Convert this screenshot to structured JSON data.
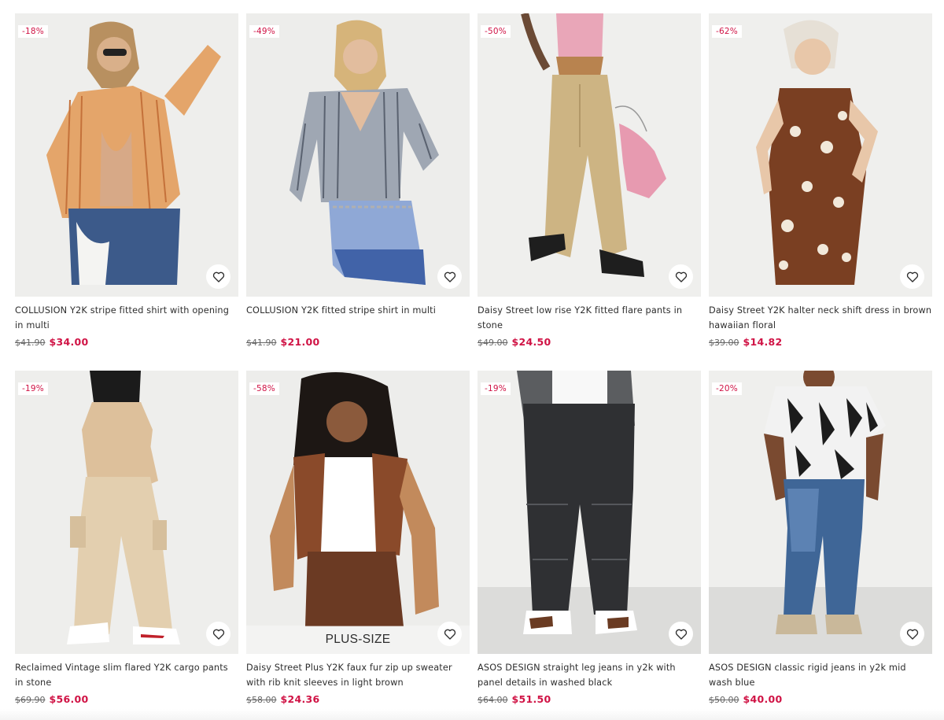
{
  "colors": {
    "sale_red": "#d01345",
    "text": "#2d2d2d",
    "old_price": "#666666"
  },
  "products": [
    {
      "badge": "-18%",
      "title": "COLLUSION Y2K stripe fitted shirt with opening in multi",
      "old_price": "$41.90",
      "price": "$34.00",
      "wishlist_icon": "heart-icon"
    },
    {
      "badge": "-49%",
      "title": "COLLUSION Y2K fitted stripe shirt in multi",
      "old_price": "$41.90",
      "price": "$21.00",
      "wishlist_icon": "heart-icon"
    },
    {
      "badge": "-50%",
      "title": "Daisy Street low rise Y2K fitted flare pants in stone",
      "old_price": "$49.00",
      "price": "$24.50",
      "wishlist_icon": "heart-icon"
    },
    {
      "badge": "-62%",
      "title": "Daisy Street Y2K halter neck shift dress in brown hawaiian floral",
      "old_price": "$39.00",
      "price": "$14.82",
      "wishlist_icon": "heart-icon"
    },
    {
      "badge": "-19%",
      "title": "Reclaimed Vintage slim flared Y2K cargo pants in stone",
      "old_price": "$69.90",
      "price": "$56.00",
      "wishlist_icon": "heart-icon"
    },
    {
      "badge": "-58%",
      "title": "Daisy Street Plus Y2K faux fur zip up sweater with rib knit sleeves in light brown",
      "old_price": "$58.00",
      "price": "$24.36",
      "wishlist_icon": "heart-icon",
      "overlay": "PLUS-SIZE"
    },
    {
      "badge": "-19%",
      "title": "ASOS DESIGN straight leg jeans in y2k with panel details in washed black",
      "old_price": "$64.00",
      "price": "$51.50",
      "wishlist_icon": "heart-icon"
    },
    {
      "badge": "-20%",
      "title": "ASOS DESIGN classic rigid jeans in y2k mid wash blue",
      "old_price": "$50.00",
      "price": "$40.00",
      "wishlist_icon": "heart-icon"
    }
  ]
}
